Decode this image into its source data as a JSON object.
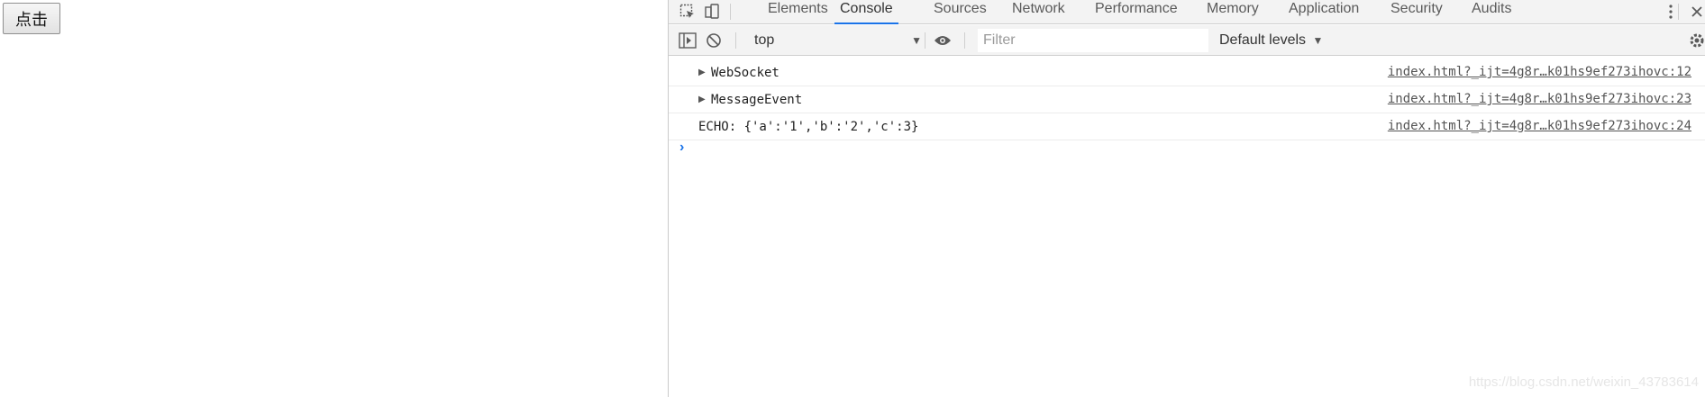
{
  "page": {
    "button_label": "点击"
  },
  "devtools": {
    "tabs": [
      "Elements",
      "Console",
      "Sources",
      "Network",
      "Performance",
      "Memory",
      "Application",
      "Security",
      "Audits"
    ],
    "active_tab": "Console",
    "toolbar": {
      "context": "top",
      "filter_placeholder": "Filter",
      "levels_label": "Default levels"
    },
    "messages": [
      {
        "text": "WebSocket",
        "expandable": true,
        "source": "index.html?_ijt=4g8r…k01hs9ef273ihovc:12"
      },
      {
        "text": "MessageEvent",
        "expandable": true,
        "source": "index.html?_ijt=4g8r…k01hs9ef273ihovc:23"
      },
      {
        "text": "ECHO: {'a':'1','b':'2','c':3}",
        "expandable": false,
        "source": "index.html?_ijt=4g8r…k01hs9ef273ihovc:24"
      }
    ],
    "prompt_symbol": "›"
  },
  "watermark": "https://blog.csdn.net/weixin_43783614",
  "colors": {
    "accent": "#1a73e8",
    "toolbar_bg": "#f3f3f3",
    "border": "#cfcfcf"
  }
}
